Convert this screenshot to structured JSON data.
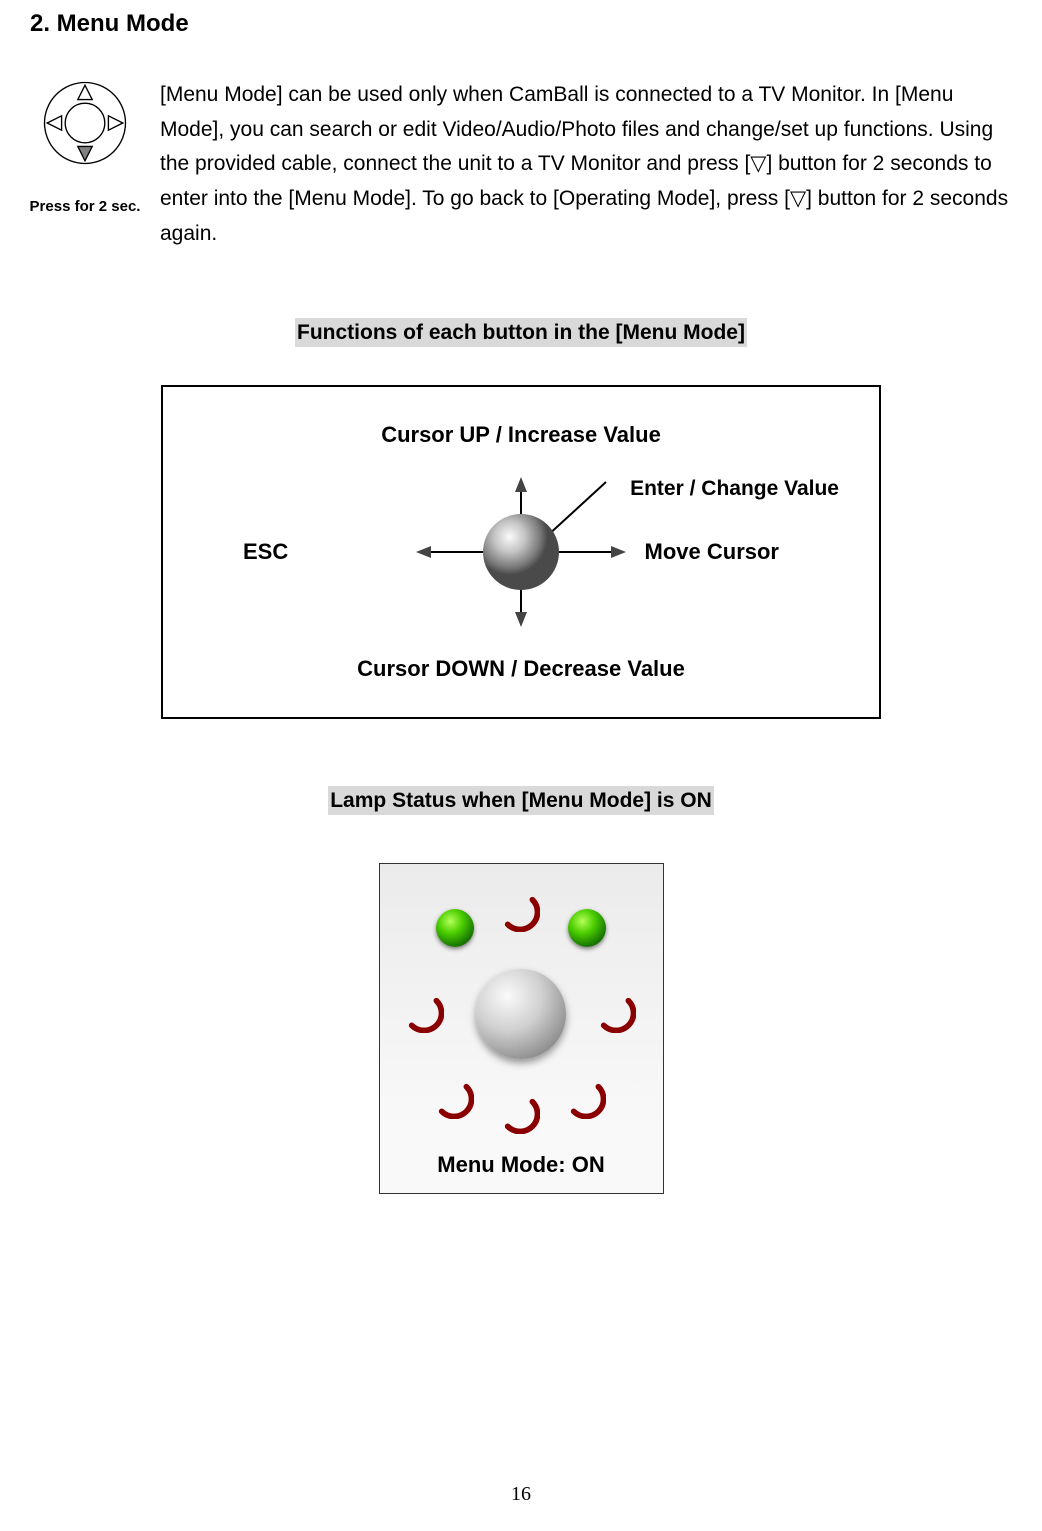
{
  "heading": "2. Menu Mode",
  "icon_caption": "Press for 2 sec.",
  "description": "[Menu Mode] can be used only when CamBall is connected to a TV Monitor. In [Menu Mode], you can search or edit Video/Audio/Photo files and change/set up functions. Using the provided cable, connect the unit to a TV Monitor and press [▽] button for 2 seconds to enter into the [Menu Mode]. To go back to [Operating Mode], press [▽] button for 2 seconds again.",
  "section_title_1": "Functions of each button in the [Menu Mode]",
  "diagram": {
    "up_label": "Cursor UP / Increase Value",
    "down_label": "Cursor DOWN / Decrease Value",
    "left_label": "ESC",
    "right_label": "Move Cursor",
    "center_label": "Enter / Change Value"
  },
  "section_title_2": "Lamp Status when [Menu Mode] is ON",
  "lamp_caption": "Menu Mode: ON",
  "page_number": "16"
}
